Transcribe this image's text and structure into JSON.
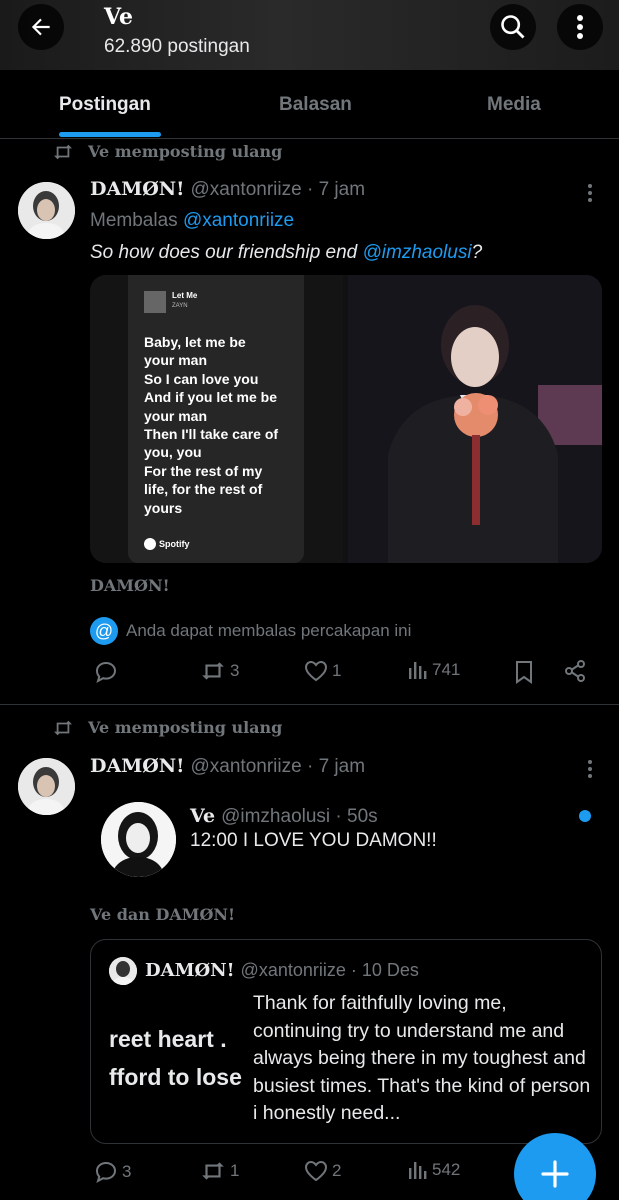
{
  "header": {
    "title": "Ve",
    "subtitle": "62.890 postingan",
    "back_icon": "arrow-left-icon",
    "search_icon": "search-icon",
    "more_icon": "more-vertical-icon"
  },
  "tabs": [
    {
      "label": "Postingan",
      "active": true
    },
    {
      "label": "Balasan",
      "active": false
    },
    {
      "label": "Media",
      "active": false
    }
  ],
  "post1": {
    "repost_label": "Ve memposting ulang",
    "author_name": "DAMØN!",
    "handle_time": "@xantonriize · 7 jam",
    "reply_prefix": "Membalas",
    "reply_to": "@xantonriize",
    "text_before": "So how does our friendship end",
    "mention": "@imzhaolusi",
    "text_after": "?",
    "lyrics_card": {
      "song": "Let Me",
      "artist": "ZAYN",
      "lines": [
        "Baby, let me be",
        "your man",
        "So I can love you",
        "And if you let me be",
        "your man",
        "Then I'll take care of",
        "you, you",
        "For the rest of my",
        "life, for the rest of",
        "yours"
      ],
      "brand": "Spotify"
    },
    "caption": "DAMØN!",
    "reply_notice": "Anda dapat membalas percakapan ini",
    "counts": {
      "replies": "",
      "reposts": "3",
      "likes": "1",
      "views": "741"
    }
  },
  "post2": {
    "repost_label": "Ve memposting ulang",
    "author_name": "DAMØN!",
    "handle_time": "@xantonriize · 7 jam",
    "embedded": {
      "name": "Ve",
      "handle_time": "@imzhaolusi · 50s",
      "text": "12:00 I LOVE YOU DAMON!!"
    },
    "people_line": "Ve dan DAMØN!",
    "quote": {
      "name": "DAMØN!",
      "handle_time": "@xantonriize · 10 Des",
      "image_text_1": "reet heart .",
      "image_text_2": "fford to lose",
      "text": "Thank for faithfully loving me, continuing try to understand me and always being there in my toughest and busiest times. That's the kind of person i honestly need..."
    },
    "counts": {
      "replies": "3",
      "reposts": "1",
      "likes": "2",
      "views": "542"
    }
  },
  "fab": {
    "icon": "plus-icon"
  },
  "colors": {
    "accent": "#1d9bf0",
    "muted": "#71767b",
    "background": "#000000"
  }
}
